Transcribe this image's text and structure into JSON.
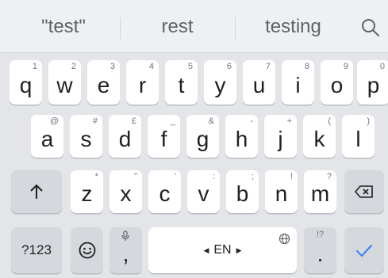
{
  "suggestions": [
    "\"test\"",
    "rest",
    "testing"
  ],
  "row1": [
    {
      "key": "q",
      "hint": "1"
    },
    {
      "key": "w",
      "hint": "2"
    },
    {
      "key": "e",
      "hint": "3"
    },
    {
      "key": "r",
      "hint": "4"
    },
    {
      "key": "t",
      "hint": "5"
    },
    {
      "key": "y",
      "hint": "6"
    },
    {
      "key": "u",
      "hint": "7"
    },
    {
      "key": "i",
      "hint": "8"
    },
    {
      "key": "o",
      "hint": "9"
    },
    {
      "key": "p",
      "hint": "0"
    }
  ],
  "row2": [
    {
      "key": "a",
      "hint": "@"
    },
    {
      "key": "s",
      "hint": "#"
    },
    {
      "key": "d",
      "hint": "£"
    },
    {
      "key": "f",
      "hint": "_"
    },
    {
      "key": "g",
      "hint": "&"
    },
    {
      "key": "h",
      "hint": "-"
    },
    {
      "key": "j",
      "hint": "+"
    },
    {
      "key": "k",
      "hint": "("
    },
    {
      "key": "l",
      "hint": ")"
    }
  ],
  "row3": [
    {
      "key": "z",
      "hint": "*"
    },
    {
      "key": "x",
      "hint": "\""
    },
    {
      "key": "c",
      "hint": "'"
    },
    {
      "key": "v",
      "hint": ":"
    },
    {
      "key": "b",
      "hint": ";"
    },
    {
      "key": "n",
      "hint": "!"
    },
    {
      "key": "m",
      "hint": "?"
    }
  ],
  "row4": {
    "symbols": "?123",
    "comma": ",",
    "space_language": "EN",
    "period": ".",
    "period_hint": "!?"
  },
  "icons": {
    "search": "search-icon",
    "shift": "shift-arrow-icon",
    "backspace": "backspace-icon",
    "emoji": "emoji-icon",
    "mic": "microphone-icon",
    "globe": "globe-icon",
    "enter": "checkmark-icon"
  },
  "colors": {
    "enter_accent": "#4285f4",
    "key_background": "#ffffff",
    "keyboard_background": "#e3e5e9"
  }
}
